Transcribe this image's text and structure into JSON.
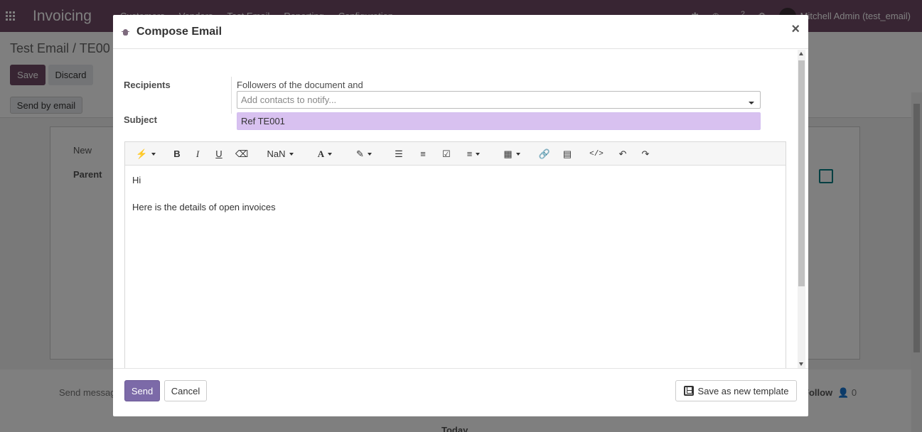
{
  "background": {
    "app_name": "Invoicing",
    "menu": [
      "Customers",
      "Vendors",
      "Test Email",
      "Reporting",
      "Configuration"
    ],
    "notification_count": "2",
    "user": "Mitchell Admin (test_email)",
    "breadcrumb": "Test Email / TE00",
    "save_label": "Save",
    "discard_label": "Discard",
    "send_by_email_label": "Send by email",
    "field_new": "New",
    "field_parent": "Parent",
    "send_message": "Send message",
    "follow": "Follow",
    "followers_count": "0",
    "today": "Today"
  },
  "modal": {
    "title": "Compose Email",
    "close": "×",
    "recipients_label": "Recipients",
    "followers_text": "Followers of the document and",
    "contacts_placeholder": "Add contacts to notify...",
    "subject_label": "Subject",
    "subject_value": "Ref TE001",
    "toolbar": {
      "font_size": "NaN"
    },
    "body_lines": [
      "Hi",
      "",
      "Here is the details of open invoices"
    ],
    "send_label": "Send",
    "cancel_label": "Cancel",
    "save_template_label": "Save as new template"
  },
  "colors": {
    "brand": "#714b67",
    "primary_button": "#7c6aa8",
    "subject_highlight": "#d8c1f0"
  }
}
